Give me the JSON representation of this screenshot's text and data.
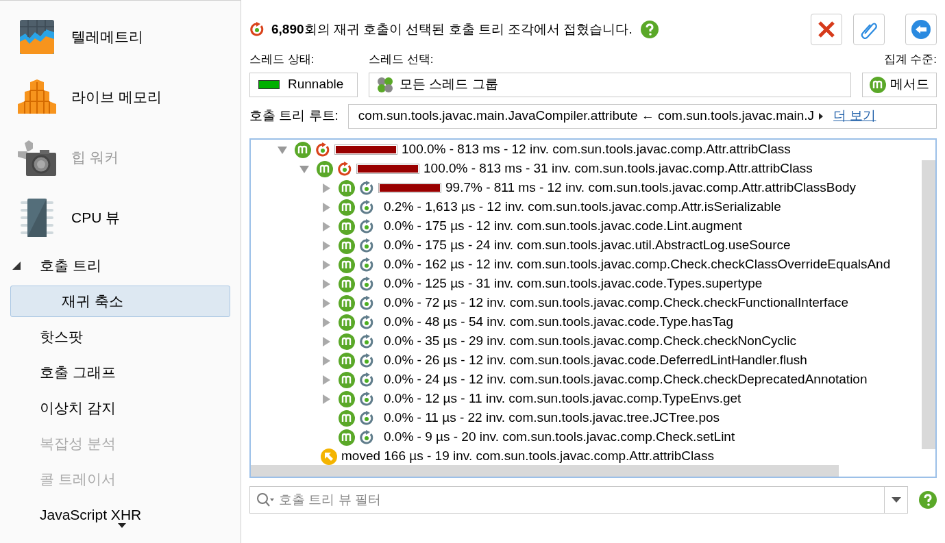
{
  "sidebar": {
    "items": [
      {
        "label": "텔레메트리",
        "kind": "telemetry",
        "disabled": false
      },
      {
        "label": "라이브 메모리",
        "kind": "memory",
        "disabled": false
      },
      {
        "label": "힙 워커",
        "kind": "heap",
        "disabled": true
      },
      {
        "label": "CPU 뷰",
        "kind": "cpu",
        "disabled": false,
        "children": [
          {
            "label": "호출 트리",
            "disabled": false,
            "selected": false,
            "expanded": true,
            "children": [
              {
                "label": "재귀 축소",
                "disabled": false,
                "selected": true
              }
            ]
          },
          {
            "label": "핫스팟",
            "disabled": false,
            "selected": false
          },
          {
            "label": "호출 그래프",
            "disabled": false,
            "selected": false
          },
          {
            "label": "이상치 감지",
            "disabled": false,
            "selected": false
          },
          {
            "label": "복잡성 분석",
            "disabled": true,
            "selected": false
          },
          {
            "label": "콜 트레이서",
            "disabled": true,
            "selected": false
          },
          {
            "label": "JavaScript XHR",
            "disabled": false,
            "selected": false
          }
        ]
      }
    ]
  },
  "header": {
    "message": "**6,890**회의 재귀 호출이 선택된 호출 트리 조각에서 접혔습니다."
  },
  "thread_status": {
    "label": "스레드 상태:",
    "value": "Runnable",
    "color": "#00b000"
  },
  "thread_selection": {
    "label": "스레드 선택:",
    "value": "모든 스레드 그룹"
  },
  "aggregation": {
    "label": "집계 수준:",
    "value": "메서드"
  },
  "call_tree_root": {
    "label": "호출 트리 루트:",
    "value": "com.sun.tools.javac.main.JavaCompiler.attribute ← com.sun.tools.javac.main.J",
    "more": "더 보기"
  },
  "tree": [
    {
      "kind": "node",
      "expanded": true,
      "recursive": true,
      "level": 1.0,
      "text": "100.0% - 813 ms - 12 inv. com.sun.tools.javac.comp.Attr.attribClass",
      "children": [
        {
          "kind": "node",
          "expanded": true,
          "recursive": true,
          "level": 1.0,
          "text": "100.0% - 813 ms - 31 inv. com.sun.tools.javac.comp.Attr.attribClass",
          "children": [
            {
              "kind": "node",
              "expanded": false,
              "recursive": false,
              "level": 0.997,
              "text": "99.7% - 811 ms - 12 inv. com.sun.tools.javac.comp.Attr.attribClassBody"
            },
            {
              "kind": "node",
              "expanded": false,
              "recursive": false,
              "text": "0.2% - 1,613 µs - 12 inv. com.sun.tools.javac.comp.Attr.isSerializable"
            },
            {
              "kind": "node",
              "expanded": false,
              "recursive": false,
              "text": "0.0% - 175 µs - 12 inv. com.sun.tools.javac.code.Lint.augment"
            },
            {
              "kind": "node",
              "expanded": false,
              "recursive": false,
              "text": "0.0% - 175 µs - 24 inv. com.sun.tools.javac.util.AbstractLog.useSource"
            },
            {
              "kind": "node",
              "expanded": false,
              "recursive": false,
              "text": "0.0% - 162 µs - 12 inv. com.sun.tools.javac.comp.Check.checkClassOverrideEqualsAnd"
            },
            {
              "kind": "node",
              "expanded": false,
              "recursive": false,
              "text": "0.0% - 125 µs - 31 inv. com.sun.tools.javac.code.Types.supertype"
            },
            {
              "kind": "node",
              "expanded": false,
              "recursive": false,
              "text": "0.0% - 72 µs - 12 inv. com.sun.tools.javac.comp.Check.checkFunctionalInterface"
            },
            {
              "kind": "node",
              "expanded": false,
              "recursive": false,
              "text": "0.0% - 48 µs - 54 inv. com.sun.tools.javac.code.Type.hasTag"
            },
            {
              "kind": "node",
              "expanded": false,
              "recursive": false,
              "text": "0.0% - 35 µs - 29 inv. com.sun.tools.javac.comp.Check.checkNonCyclic"
            },
            {
              "kind": "node",
              "expanded": false,
              "recursive": false,
              "text": "0.0% - 26 µs - 12 inv. com.sun.tools.javac.code.DeferredLintHandler.flush"
            },
            {
              "kind": "node",
              "expanded": false,
              "recursive": false,
              "text": "0.0% - 24 µs - 12 inv. com.sun.tools.javac.comp.Check.checkDeprecatedAnnotation"
            },
            {
              "kind": "node",
              "expanded": false,
              "recursive": false,
              "text": "0.0% - 12 µs - 11 inv. com.sun.tools.javac.comp.TypeEnvs.get"
            },
            {
              "kind": "leaf",
              "recursive": false,
              "text": "0.0% - 11 µs - 22 inv. com.sun.tools.javac.tree.JCTree.pos"
            },
            {
              "kind": "leaf",
              "recursive": false,
              "text": "0.0% - 9 µs - 20 inv. com.sun.tools.javac.comp.Check.setLint"
            },
            {
              "kind": "moved",
              "text": "moved 166 µs - 19 inv.  com.sun.tools.javac.comp.Attr.attribClass"
            }
          ]
        }
      ]
    }
  ],
  "filter": {
    "placeholder": "호출 트리 뷰 필터"
  }
}
